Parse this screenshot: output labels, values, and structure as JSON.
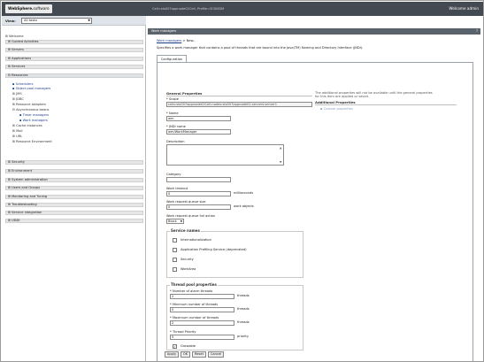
{
  "header": {
    "brand_bold": "WebSphere.",
    "brand_light": "software",
    "cell_path": "Cell=slo007appnode02Cell, Profile=SI300DM",
    "welcome": "Welcome admin"
  },
  "nav": {
    "view_label": "View:",
    "view_value": "All tasks",
    "welcome": "Welcome",
    "items": [
      "Guided Activities",
      "Servers",
      "Applications",
      "Services",
      "Resources",
      "Security",
      "Environment",
      "System administration",
      "Users and Groups",
      "Monitoring and Tuning",
      "Troubleshooting",
      "Service integration",
      "UDDI"
    ],
    "resources_children": {
      "schedulers": "Schedulers",
      "object_pool": "Object pool managers",
      "jms": "JMS",
      "jdbc": "JDBC",
      "resource_adapters": "Resource Adapters",
      "async_beans": "Asynchronous beans",
      "timer_managers": "Timer managers",
      "work_managers": "Work managers",
      "cache_instances": "Cache instances",
      "mail": "Mail",
      "url": "URL",
      "resource_env": "Resource Environment"
    }
  },
  "content": {
    "banner_title": "Work managers",
    "banner_close": "?",
    "breadcrumb_link": "Work managers",
    "breadcrumb_rest": "> New...",
    "description": "Specifies a work manager that contains a pool of threads that are bound into the Java(TM) Naming and Directory Interface (JNDI).",
    "tab": "Configuration",
    "general_heading": "General Properties",
    "additional_note_line1": "The additional properties will not be available until the general properties",
    "additional_note_line2": "for this item are applied or saved.",
    "additional_heading": "Additional Properties",
    "additional_link": "Custom properties",
    "scope_label": "Scope",
    "scope_value": "cells:slo007appnode02Cell:nodes:slo007appnode01:servers:server1",
    "name_label": "Name",
    "name_value": "wm",
    "jndi_label": "JNDI name",
    "jndi_value": "wm/WorkManager",
    "description_label": "Description",
    "description_value": "",
    "category_label": "Category",
    "category_value": "",
    "timeout_label": "Work timeout",
    "timeout_value": "0",
    "timeout_unit": "milliseconds",
    "queue_size_label": "Work request queue size",
    "queue_size_value": "0",
    "queue_size_unit": "work objects",
    "queue_full_label": "Work request queue full action",
    "queue_full_value": "Block",
    "service_names_title": "Service names",
    "services": [
      {
        "label": "Internationalization",
        "checked": false
      },
      {
        "label": "Application Profiling Service (deprecated)",
        "checked": false
      },
      {
        "label": "Security",
        "checked": false
      },
      {
        "label": "WorkArea",
        "checked": false
      }
    ],
    "thread_pool_title": "Thread pool properties",
    "alarm_label": "Number of alarm threads",
    "alarm_value": "2",
    "alarm_unit": "threads",
    "min_label": "Minimum number of threads",
    "min_value": "0",
    "min_unit": "threads",
    "max_label": "Maximum number of threads",
    "max_value": "2",
    "max_unit": "threads",
    "priority_label": "Thread Priority",
    "priority_value": "5",
    "priority_unit": "priority",
    "growable_label": "Growable",
    "growable_checked": true,
    "buttons": {
      "apply": "Apply",
      "ok": "OK",
      "reset": "Reset",
      "cancel": "Cancel"
    }
  }
}
